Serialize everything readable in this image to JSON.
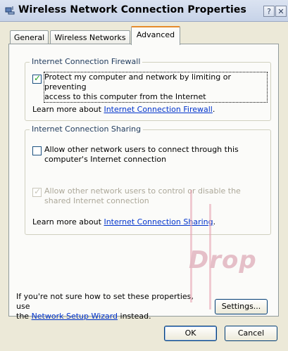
{
  "window": {
    "title": "Wireless Network Connection Properties",
    "help_label": "?",
    "close_label": "✕"
  },
  "tabs": [
    {
      "label": "General"
    },
    {
      "label": "Wireless Networks"
    },
    {
      "label": "Advanced",
      "active": true
    }
  ],
  "firewall": {
    "group_label": "Internet Connection Firewall",
    "checkbox_line1": "Protect my computer and network by limiting or preventing",
    "checkbox_line2": "access to this computer from the Internet",
    "checked": true,
    "learn_prefix": "Learn more about ",
    "learn_link": "Internet Connection Firewall",
    "learn_suffix": "."
  },
  "sharing": {
    "group_label": "Internet Connection Sharing",
    "allow_connect_line1": "Allow other network users to connect through this",
    "allow_connect_line2": "computer's Internet connection",
    "allow_connect_checked": false,
    "allow_control_line1": "Allow other network users to control or disable the",
    "allow_control_line2": "shared Internet connection",
    "allow_control_checked": true,
    "learn_prefix": "Learn more about ",
    "learn_link": "Internet Connection Sharing",
    "learn_suffix": "."
  },
  "footer": {
    "hint_line1": "If you're not sure how to set these properties, use",
    "hint_prefix": "the ",
    "hint_link": "Network Setup Wizard",
    "hint_suffix": " instead.",
    "settings_label": "Settings..."
  },
  "buttons": {
    "ok_label": "OK",
    "cancel_label": "Cancel"
  },
  "watermark": {
    "text": "Drop"
  },
  "colors": {
    "accent_tab": "#e68b2c",
    "link": "#0033cc",
    "check": "#21a121"
  }
}
